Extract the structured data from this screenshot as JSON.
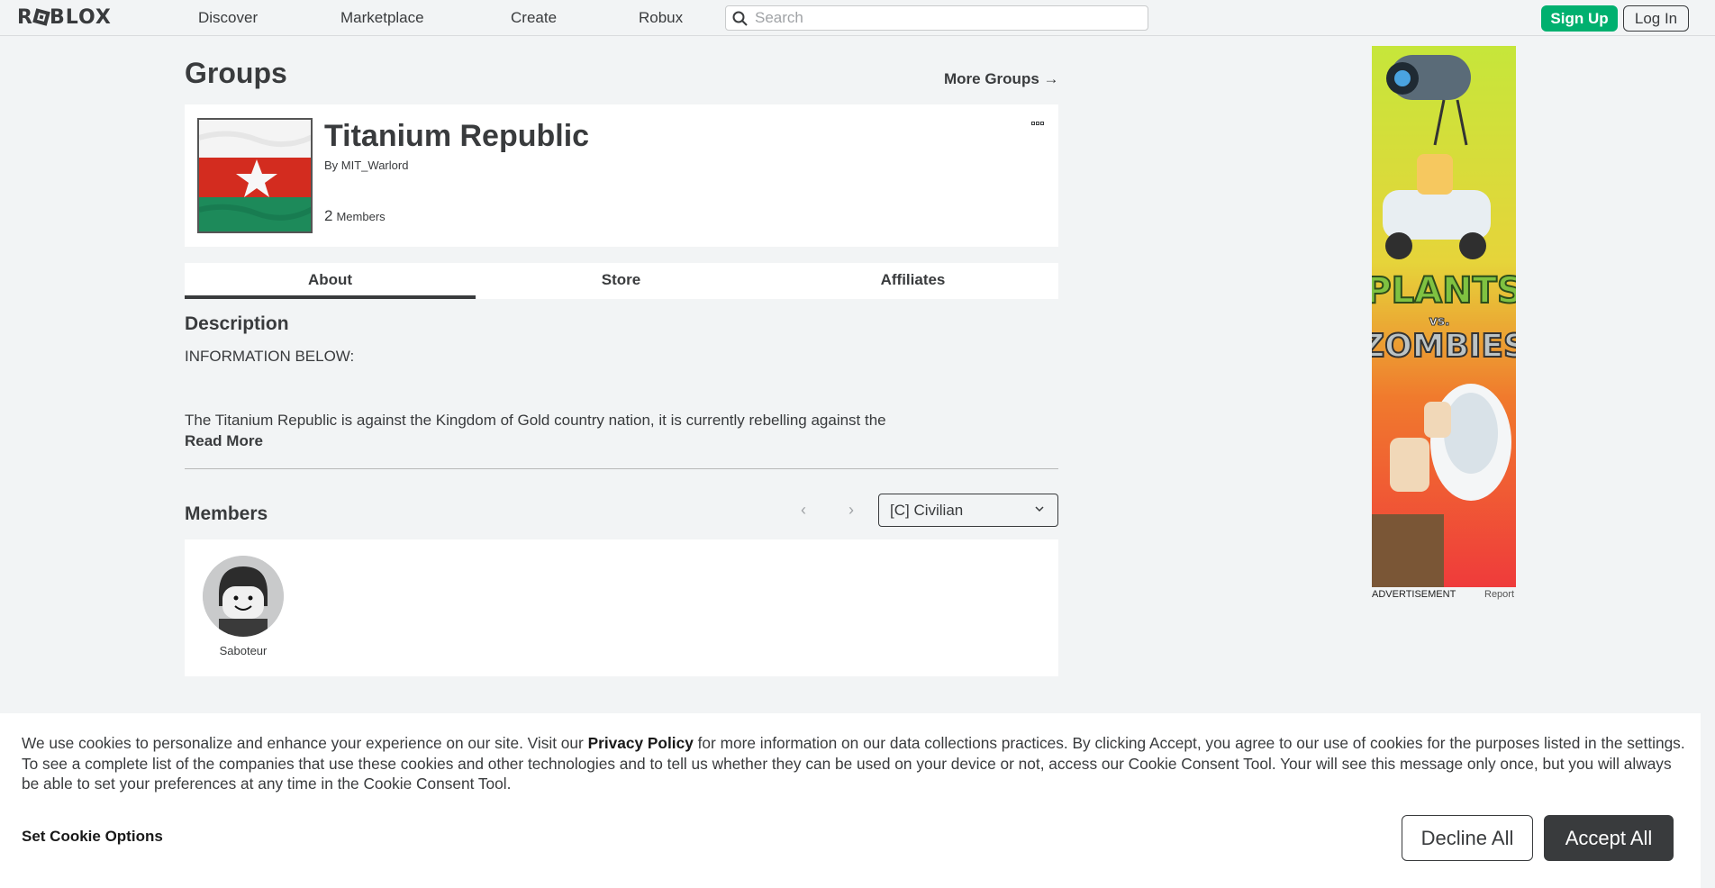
{
  "nav": {
    "logo": "ROBLOX",
    "links": [
      "Discover",
      "Marketplace",
      "Create",
      "Robux"
    ],
    "search_placeholder": "Search",
    "signup": "Sign Up",
    "login": "Log In"
  },
  "page": {
    "title": "Groups",
    "more_groups": "More Groups →"
  },
  "group": {
    "name": "Titanium Republic",
    "by": "By",
    "owner": "MIT_Warlord",
    "member_count": "2",
    "members_label": "Members"
  },
  "tabs": [
    "About",
    "Store",
    "Affiliates"
  ],
  "description": {
    "title": "Description",
    "line1": "INFORMATION BELOW:",
    "line2": "The Titanium Republic is against the Kingdom of Gold country nation, it is currently rebelling against the",
    "read_more": "Read More"
  },
  "members": {
    "title": "Members",
    "prev": "‹",
    "next": "›",
    "role": "[C] Civilian",
    "list": [
      {
        "name": "Saboteur"
      }
    ]
  },
  "ad": {
    "label": "ADVERTISEMENT",
    "report": "Report",
    "headline_top": "PLANTS",
    "headline_mid": "vs.",
    "headline_bottom": "ZOMBIES"
  },
  "cookie": {
    "text_before": "We use cookies to personalize and enhance your experience on our site. Visit our ",
    "privacy_link": "Privacy Policy",
    "text_after": " for more information on our data collections practices. By clicking Accept, you agree to our use of cookies for the purposes listed in the settings. To see a complete list of the companies that use these cookies and other technologies and to tell us whether they can be used on your device or not, access our Cookie Consent Tool. Your will see this message only once, but you will always be able to set your preferences at any time in the Cookie Consent Tool.",
    "set_options": "Set Cookie Options",
    "decline": "Decline All",
    "accept": "Accept All"
  },
  "colors": {
    "signup_green": "#00b06f",
    "text_dark": "#393b3d",
    "background": "#f2f4f5"
  }
}
